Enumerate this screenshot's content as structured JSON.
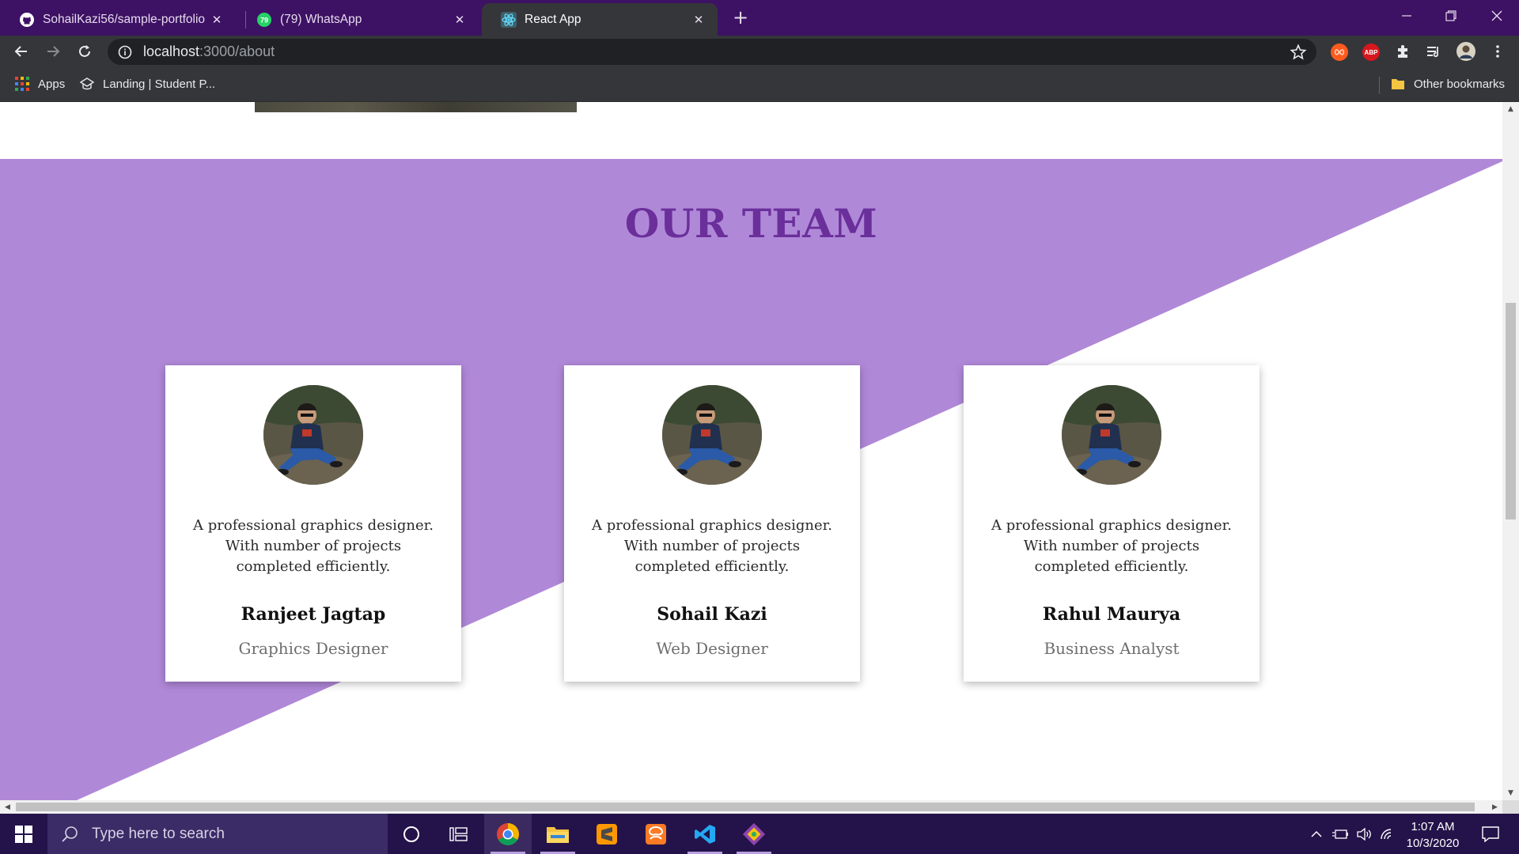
{
  "browser": {
    "tabs": [
      {
        "title": "SohailKazi56/sample-portfolio",
        "icon": "github-icon",
        "active": false
      },
      {
        "title": "(79) WhatsApp",
        "icon": "whatsapp-icon",
        "badge": "79",
        "active": false
      },
      {
        "title": "React App",
        "icon": "react-icon",
        "active": true
      }
    ],
    "url_host": "localhost",
    "url_path": ":3000/about",
    "bookmarks": {
      "apps_label": "Apps",
      "landing_label": "Landing | Student P...",
      "other_label": "Other bookmarks"
    },
    "extensions": {
      "abp_label": "ABP"
    }
  },
  "page": {
    "team_title": "OUR TEAM",
    "colors": {
      "section_purple": "#b088d8",
      "title_purple": "#6a2f9a"
    },
    "members": [
      {
        "name": "Ranjeet Jagtap",
        "role": "Graphics Designer",
        "desc": "A professional graphics designer. With number of projects completed efficiently."
      },
      {
        "name": "Sohail Kazi",
        "role": "Web Designer",
        "desc": "A professional graphics designer. With number of projects completed efficiently."
      },
      {
        "name": "Rahul Maurya",
        "role": "Business Analyst",
        "desc": "A professional graphics designer. With number of projects completed efficiently."
      }
    ]
  },
  "taskbar": {
    "search_placeholder": "Type here to search",
    "time": "1:07 AM",
    "date": "10/3/2020",
    "apps": [
      "chrome-icon",
      "file-explorer-icon",
      "sublime-text-icon",
      "xampp-icon",
      "vscode-icon",
      "git-icon"
    ]
  }
}
